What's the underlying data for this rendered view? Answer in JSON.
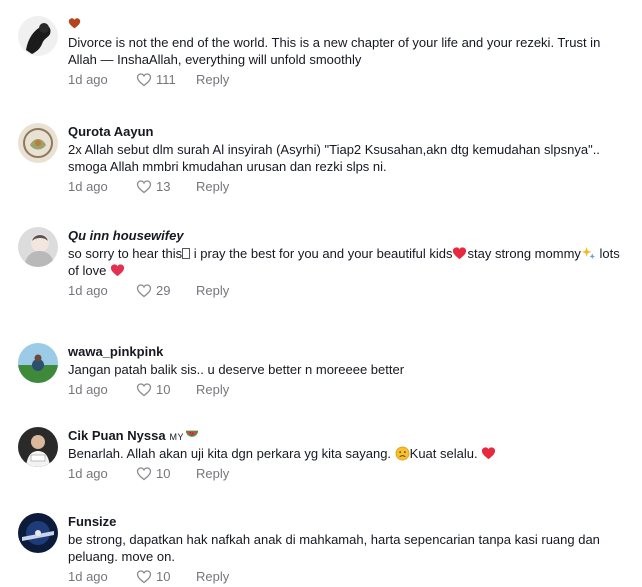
{
  "comments": [
    {
      "username": "",
      "text": "Divorce is not the end of the world. This is a new chapter of your life and your rezeki. Trust in Allah — InshaAllah, everything will unfold smoothly",
      "time": "1d ago",
      "likes": "111",
      "reply_label": "Reply"
    },
    {
      "username": "Qurota Aayun",
      "text": "2x Allah sebut dlm surah Al insyirah (Asyrhi) \"Tiap2 Ksusahan,akn dtg kemudahan slpsnya\".. smoga Allah mmbri kmudahan urusan dan rezki slps ni.",
      "time": "1d ago",
      "likes": "13",
      "reply_label": "Reply"
    },
    {
      "username": "Qu inn housewifey",
      "text_a": "so sorry to hear this",
      "text_b": " i pray the best for you and your beautiful kids",
      "text_c": "stay strong mommy",
      "text_d": " lots of love ",
      "time": "1d ago",
      "likes": "29",
      "reply_label": "Reply"
    },
    {
      "username": "wawa_pinkpink",
      "text": "Jangan patah balik sis.. u deserve better n moreeee better",
      "time": "1d ago",
      "likes": "10",
      "reply_label": "Reply"
    },
    {
      "username": "Cik Puan Nyssa",
      "username_suffix": "MY",
      "text_a": "Benarlah. Allah akan uji kita dgn perkara yg kita sayang. ",
      "text_b": "Kuat selalu. ",
      "time": "1d ago",
      "likes": "10",
      "reply_label": "Reply"
    },
    {
      "username": "Funsize",
      "text": "be strong, dapatkan hak nafkah anak di mahkamah, harta sepencarian tanpa kasi ruang dan peluang. move on.",
      "time": "1d ago",
      "likes": "10",
      "reply_label": "Reply"
    }
  ],
  "icons": {
    "like": "heart-outline-icon",
    "username_emoji_1": "heart-emoji",
    "username_emoji_5": "watermelon-emoji"
  },
  "colors": {
    "text": "#161823",
    "secondary_text": "#8a8b91",
    "emoji_red": "#e8283c"
  }
}
